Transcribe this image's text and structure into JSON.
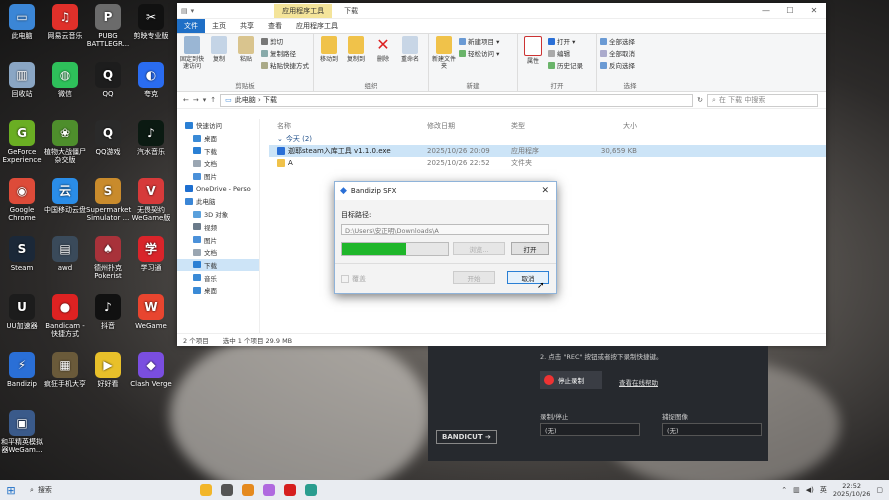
{
  "desktop": {
    "icons": [
      {
        "label": "此电脑",
        "color": "#3b86d6",
        "glyph": "▭"
      },
      {
        "label": "网易云音乐",
        "color": "#e0302a",
        "glyph": "♫"
      },
      {
        "label": "PUBG BATTLEGR...",
        "color": "#6b6b6b",
        "glyph": "P"
      },
      {
        "label": "剪映专业版",
        "color": "#111111",
        "glyph": "✂"
      },
      {
        "label": "回收站",
        "color": "#8aa6c4",
        "glyph": "▥"
      },
      {
        "label": "微信",
        "color": "#2ec05a",
        "glyph": "◍"
      },
      {
        "label": "QQ",
        "color": "#1d1d1d",
        "glyph": "Q"
      },
      {
        "label": "夸克",
        "color": "#2a6cf0",
        "glyph": "◐"
      },
      {
        "label": "GeForce Experience",
        "color": "#6aae23",
        "glyph": "G"
      },
      {
        "label": "植物大战僵尸杂交版",
        "color": "#4e8e2c",
        "glyph": "❀"
      },
      {
        "label": "QQ游戏",
        "color": "#2a2a2a",
        "glyph": "Q"
      },
      {
        "label": "汽水音乐",
        "color": "#0b1a12",
        "glyph": "♪"
      },
      {
        "label": "Google Chrome",
        "color": "#dd4b39",
        "glyph": "◉"
      },
      {
        "label": "中国移动云盘",
        "color": "#2a8de8",
        "glyph": "云"
      },
      {
        "label": "Supermarket Simulator ...",
        "color": "#c98b2c",
        "glyph": "S"
      },
      {
        "label": "无畏契约 WeGame版",
        "color": "#d63a3a",
        "glyph": "V"
      },
      {
        "label": "Steam",
        "color": "#1b2838",
        "glyph": "S"
      },
      {
        "label": "awd",
        "color": "#3a4a5a",
        "glyph": "▤"
      },
      {
        "label": "德州扑克 Pokerist",
        "color": "#a8323a",
        "glyph": "♠"
      },
      {
        "label": "学习通",
        "color": "#d9242a",
        "glyph": "学"
      },
      {
        "label": "UU加速器",
        "color": "#1c1c1c",
        "glyph": "U"
      },
      {
        "label": "Bandicam - 快捷方式",
        "color": "#dd2222",
        "glyph": "●"
      },
      {
        "label": "抖音",
        "color": "#111111",
        "glyph": "♪"
      },
      {
        "label": "WeGame",
        "color": "#e8452f",
        "glyph": "W"
      },
      {
        "label": "Bandizip",
        "color": "#2a6fd6",
        "glyph": "⚡"
      },
      {
        "label": "疯狂手机大亨",
        "color": "#6a5a3a",
        "glyph": "▦"
      },
      {
        "label": "好好看",
        "color": "#e8c02a",
        "glyph": "▶"
      },
      {
        "label": "Clash Verge",
        "color": "#7a4ee0",
        "glyph": "◆"
      },
      {
        "label": "和平精英模拟器WeGam...",
        "color": "#3a5a8a",
        "glyph": "▣"
      }
    ]
  },
  "explorer": {
    "title": "下载",
    "context_tab": "应用程序工具",
    "tabs": [
      "文件",
      "主页",
      "共享",
      "查看",
      "应用程序工具"
    ],
    "ribbon": {
      "clipboard": {
        "label": "剪贴板",
        "pin": "固定到快速访问",
        "copy": "复制",
        "paste": "粘贴",
        "cut": "剪切",
        "copy_path": "复制路径",
        "paste_shortcut": "粘贴快捷方式"
      },
      "organize": {
        "label": "组织",
        "move_to": "移动到",
        "copy_to": "复制到",
        "delete": "删除",
        "rename": "重命名"
      },
      "new": {
        "label": "新建",
        "new_folder": "新建文件夹",
        "new_item": "新建项目 ▾",
        "easy_access": "轻松访问 ▾"
      },
      "open": {
        "label": "打开",
        "properties": "属性",
        "open": "打开 ▾",
        "edit": "编辑",
        "history": "历史记录"
      },
      "select": {
        "label": "选择",
        "select_all": "全部选择",
        "select_none": "全部取消",
        "invert": "反向选择"
      }
    },
    "address": {
      "path": "此电脑 › 下载",
      "search_placeholder": "在 下载 中搜索"
    },
    "nav": [
      {
        "label": "快速访问",
        "color": "#2a7fd4"
      },
      {
        "label": "桌面",
        "color": "#3a8ad6"
      },
      {
        "label": "下载",
        "color": "#2a7fd4"
      },
      {
        "label": "文档",
        "color": "#9aa6b2"
      },
      {
        "label": "图片",
        "color": "#4a90d9"
      },
      {
        "label": "OneDrive - Perso",
        "color": "#1e6fd0"
      },
      {
        "label": "此电脑",
        "color": "#3b86d6"
      },
      {
        "label": "3D 对象",
        "color": "#5aa0dc"
      },
      {
        "label": "视频",
        "color": "#6a7a8a"
      },
      {
        "label": "图片",
        "color": "#4a90d9"
      },
      {
        "label": "文档",
        "color": "#9aa6b2"
      },
      {
        "label": "下载",
        "color": "#2a7fd4"
      },
      {
        "label": "音乐",
        "color": "#3a8ad6"
      },
      {
        "label": "桌面",
        "color": "#3a8ad6"
      }
    ],
    "columns": {
      "name": "名称",
      "date": "修改日期",
      "type": "类型",
      "size": "大小"
    },
    "group": "今天 (2)",
    "files": [
      {
        "name": "迦耶steam入库工具 v1.1.0.exe",
        "date": "2025/10/26 20:09",
        "type": "应用程序",
        "size": "30,659 KB",
        "color": "#2a6fd6"
      },
      {
        "name": "A",
        "date": "2025/10/26 22:52",
        "type": "文件夹",
        "size": "",
        "color": "#f0c24a"
      }
    ],
    "status": {
      "count": "2 个项目",
      "selected": "选中 1 个项目  29.9 MB"
    }
  },
  "dialog": {
    "title": "Bandizip SFX",
    "label": "目标路径:",
    "path": "D:\\Users\\安正明\\Downloads\\A",
    "progress": 0.6,
    "browse": "浏览...",
    "open": "打开",
    "overwrite": "覆盖",
    "start": "开始",
    "cancel": "取消"
  },
  "bandicut": {
    "step": "2. 点击 \"REC\" 按钮或者按下录制快捷键。",
    "stop": "停止录制",
    "help": "查看在线帮助",
    "rec_label": "录制/停止",
    "snap_label": "捕捉图像",
    "rec_value": "(无)",
    "snap_value": "(无)",
    "logo": "BANDICUT ➔"
  },
  "taskbar": {
    "search": "搜索",
    "lang": "英",
    "time": "22:52",
    "date": "2025/10/26",
    "apps": [
      "#f2b62a",
      "#555555",
      "#e58a1f",
      "#b06adf",
      "#d62020",
      "#2a9d8f"
    ]
  }
}
